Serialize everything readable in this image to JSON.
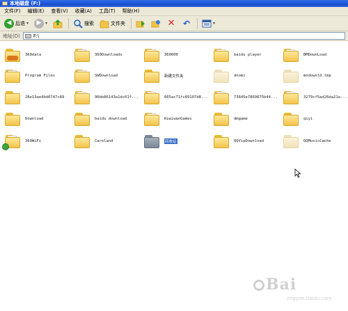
{
  "window": {
    "title": "本地磁盘 (F:)"
  },
  "menu": [
    "文件(F)",
    "编辑(E)",
    "查看(V)",
    "收藏(A)",
    "工具(T)",
    "帮助(H)"
  ],
  "toolbar": {
    "back_label": "后退",
    "search_label": "搜索",
    "folders_label": "文件夹"
  },
  "address": {
    "label": "地址(D)",
    "path": "F:\\"
  },
  "items": [
    {
      "label": "360data",
      "icon": "folder-app-icon"
    },
    {
      "label": "360Downloads",
      "icon": "folder-icon"
    },
    {
      "label": "360000",
      "icon": "folder-icon"
    },
    {
      "label": "baidu player",
      "icon": "folder-icon"
    },
    {
      "label": "BMDownLoad",
      "icon": "folder-icon"
    },
    {
      "label": "Program Files",
      "icon": "folder-icon"
    },
    {
      "label": "SWDownload",
      "icon": "folder-icon"
    },
    {
      "label": "新建文件夹",
      "icon": "folder-icon"
    },
    {
      "label": "dnomi",
      "icon": "hidden-folder-icon"
    },
    {
      "label": "mndownld.tmp",
      "icon": "hidden-folder-icon"
    },
    {
      "label": "28e13ae4bd0747c89",
      "icon": "folder-icon"
    },
    {
      "label": "96bb86143a1dc01f...",
      "icon": "folder-icon"
    },
    {
      "label": "665ac71fc89107d8...",
      "icon": "folder-icon"
    },
    {
      "label": "73645e7869675b44...",
      "icon": "folder-icon"
    },
    {
      "label": "3279cf5ad26da21a...",
      "icon": "folder-icon"
    },
    {
      "label": "Download",
      "icon": "folder-icon"
    },
    {
      "label": "baidu download",
      "icon": "folder-icon"
    },
    {
      "label": "KuaiwanGames",
      "icon": "folder-icon"
    },
    {
      "label": "dmgame",
      "icon": "folder-icon"
    },
    {
      "label": "qiyi",
      "icon": "folder-icon"
    },
    {
      "label": "360WiFi",
      "icon": "folder-wifi-icon"
    },
    {
      "label": "Careland",
      "icon": "folder-icon"
    },
    {
      "label": "回收站",
      "icon": "gray-folder-icon",
      "selected": true
    },
    {
      "label": "QQVipDownload",
      "icon": "folder-icon"
    },
    {
      "label": "QQMusicCache",
      "icon": "hidden-folder-icon"
    }
  ],
  "watermark": {
    "brand": "Bai",
    "url": "jingyan.baidu.com"
  }
}
